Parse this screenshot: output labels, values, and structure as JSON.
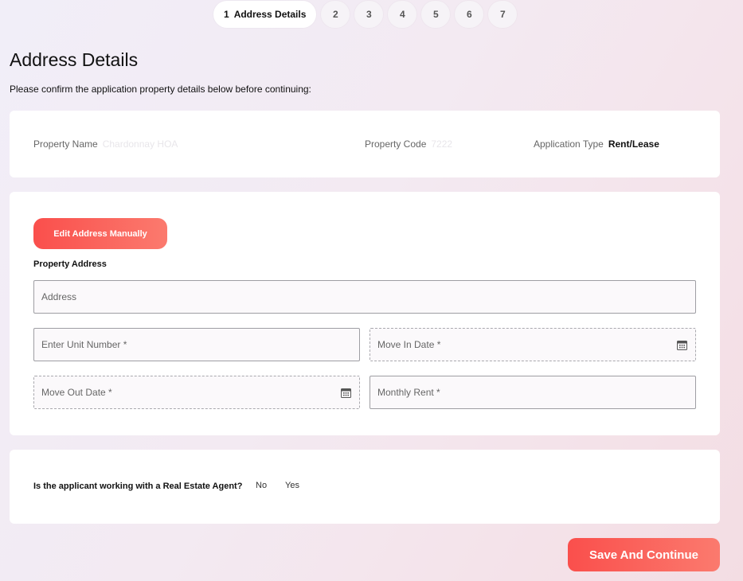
{
  "stepper": {
    "active": {
      "number": "1",
      "label": "Address Details"
    },
    "steps": [
      "2",
      "3",
      "4",
      "5",
      "6",
      "7"
    ]
  },
  "page": {
    "title": "Address Details",
    "subtitle": "Please confirm the application property details below before continuing:"
  },
  "property": {
    "name_label": "Property Name",
    "name_value": "Chardonnay HOA",
    "code_label": "Property Code",
    "code_value": "7222",
    "type_label": "Application Type",
    "type_value": "Rent/Lease"
  },
  "address_form": {
    "edit_button": "Edit Address Manually",
    "section_label": "Property Address",
    "address_placeholder": "Address",
    "unit_placeholder": "Enter Unit Number *",
    "move_in_placeholder": "Move In Date *",
    "move_out_placeholder": "Move Out Date *",
    "rent_placeholder": "Monthly Rent *"
  },
  "agent": {
    "question": "Is the applicant working with a Real Estate Agent?",
    "options": [
      "No",
      "Yes"
    ]
  },
  "actions": {
    "save": "Save And Continue"
  },
  "icons": {
    "date_picker": "calendar-icon"
  },
  "colors": {
    "accent_start": "#fa4f4c",
    "accent_end": "#fb7a6e"
  }
}
